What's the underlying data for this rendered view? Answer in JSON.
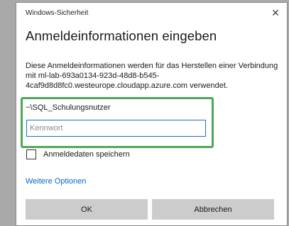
{
  "window": {
    "title": "Windows-Sicherheit",
    "close_symbol": "✕",
    "close_icon": "close-icon"
  },
  "dialog": {
    "heading": "Anmeldeinformationen eingeben",
    "description": "Diese Anmeldeinformationen werden für das Herstellen einer Verbindung mit ml-lab-693a0134-923d-48d8-b545-4caf9d8d8fc0.westeurope.cloudapp.azure.com verwendet.",
    "username": "~\\SQL_Schulungsnutzer",
    "password_value": "",
    "password_placeholder": "Kennwort",
    "remember_label": "Anmeldedaten speichern",
    "remember_checked": false,
    "more_options": "Weitere Optionen"
  },
  "buttons": {
    "ok": "OK",
    "cancel": "Abbrechen"
  },
  "colors": {
    "highlight": "#4ca85a",
    "link": "#0a66c2",
    "input_border": "#1e6fc0",
    "button_bg": "#cccccc"
  }
}
